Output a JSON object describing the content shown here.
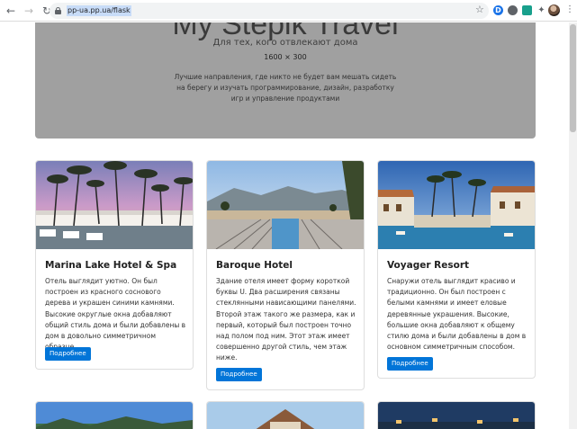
{
  "browser": {
    "url": "pp-ua.pp.ua/flask",
    "back_icon": "←",
    "forward_icon": "→",
    "reload_icon": "↻",
    "star_icon": "☆",
    "extensions_icon": "✦",
    "menu_icon": "⋮",
    "ext_d": "D"
  },
  "hero": {
    "title": "My Stepik Travel",
    "subtitle": "Для тех, кого отвлекают дома",
    "size_label": "1600 × 300",
    "lead": "Лучшие направления, где никто не будет вам мешать сидеть на берегу и изучать программирование, дизайн, разработку игр и управление продуктами"
  },
  "cards": [
    {
      "title": "Marina Lake Hotel & Spa",
      "text": "Отель выглядит уютно. Он был построен из красного соснового дерева и украшен синими камнями. Высокие округлые окна добавляют общий стиль дома и были добавлены в дом в довольно симметричном образце.",
      "button": "Подробнее"
    },
    {
      "title": "Baroque Hotel",
      "text": "Здание отеля имеет форму короткой буквы U. Два расширения связаны стеклянными нависающими панелями. Второй этаж такого же размера, как и первый, который был построен точно над полом под ним. Этот этаж имеет совершенно другой стиль, чем этаж ниже.",
      "button": "Подробнее"
    },
    {
      "title": "Voyager Resort",
      "text": "Снаружи отель выглядит красиво и традиционно. Он был построен с белыми камнями и имеет еловые деревянные украшения. Высокие, большие окна добавляют к общему стилю дома и были добавлены в дом в основном симметричным способом.",
      "button": "Подробнее"
    }
  ]
}
